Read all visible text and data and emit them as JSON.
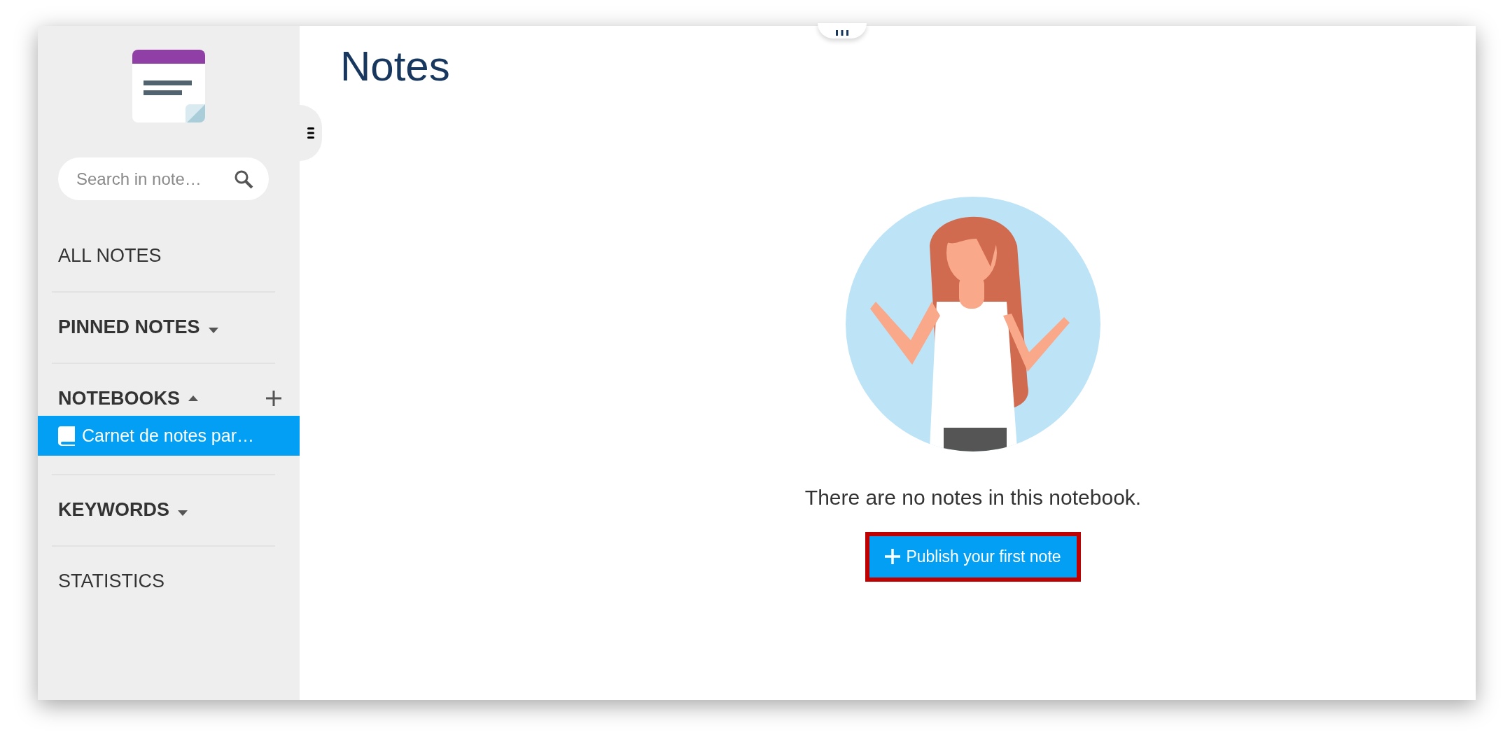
{
  "sidebar": {
    "search": {
      "placeholder": "Search in note…"
    },
    "items": [
      {
        "kind": "link",
        "label": "ALL NOTES"
      },
      {
        "kind": "dropdown",
        "label": "PINNED NOTES",
        "expanded": false
      },
      {
        "kind": "dropdown",
        "label": "NOTEBOOKS",
        "expanded": true,
        "add_button": true,
        "children": [
          {
            "label": "Carnet de notes par…",
            "selected": true
          }
        ]
      },
      {
        "kind": "dropdown",
        "label": "KEYWORDS",
        "expanded": false
      },
      {
        "kind": "link",
        "label": "STATISTICS"
      }
    ]
  },
  "main": {
    "title": "Notes",
    "empty_message": "There are no notes in this notebook.",
    "button": {
      "label": "Publish your first note",
      "highlighted": true
    }
  }
}
